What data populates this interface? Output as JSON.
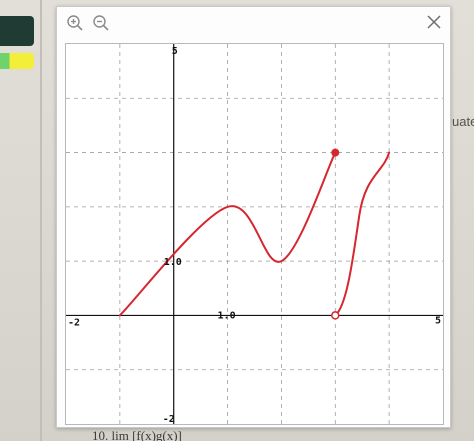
{
  "background": {
    "right_partial_text": "uate",
    "bottom_partial_text": "10. lim [f(x)g(x)]"
  },
  "toolbar": {
    "zoom_in_icon": "zoom-in-icon",
    "zoom_out_icon": "zoom-out-icon",
    "close_icon": "close-icon"
  },
  "colors": {
    "curve": "#d6262f",
    "grid": "#9e9e9e",
    "axis": "#111111"
  },
  "chart_data": {
    "type": "line",
    "xlim": [
      -2,
      5
    ],
    "ylim": [
      -2,
      5
    ],
    "grid": true,
    "grid_style": "dashed",
    "tick_labels": {
      "x_min": "-2",
      "x_unit": "1.0",
      "x_max": "5",
      "y_min": "-2",
      "y_unit": "1.0",
      "y_max": "5"
    },
    "series": [
      {
        "points": [
          [
            -1,
            0
          ],
          [
            1,
            2
          ],
          [
            2,
            1
          ],
          [
            3,
            3
          ]
        ],
        "end_marker": {
          "x": 3,
          "y": 3,
          "style": "closed"
        }
      },
      {
        "points": [
          [
            3,
            0
          ],
          [
            4,
            3
          ]
        ],
        "start_marker": {
          "x": 3,
          "y": 0,
          "style": "open"
        }
      }
    ]
  }
}
